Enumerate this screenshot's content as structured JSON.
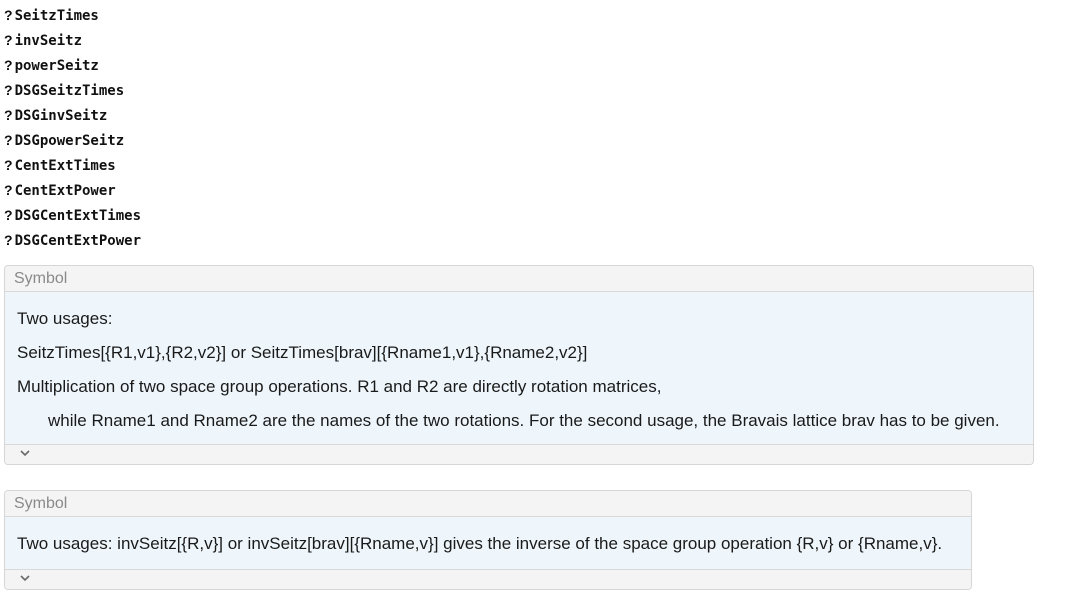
{
  "queries": [
    {
      "mark": "?",
      "name": "SeitzTimes"
    },
    {
      "mark": "?",
      "name": "invSeitz"
    },
    {
      "mark": "?",
      "name": "powerSeitz"
    },
    {
      "mark": "?",
      "name": "DSGSeitzTimes"
    },
    {
      "mark": "?",
      "name": "DSGinvSeitz"
    },
    {
      "mark": "?",
      "name": "DSGpowerSeitz"
    },
    {
      "mark": "?",
      "name": "CentExtTimes"
    },
    {
      "mark": "?",
      "name": "CentExtPower"
    },
    {
      "mark": "?",
      "name": "DSGCentExtTimes"
    },
    {
      "mark": "?",
      "name": "DSGCentExtPower"
    }
  ],
  "panels": [
    {
      "header": "Symbol",
      "lines": [
        "Two usages:",
        "SeitzTimes[{R1,v1},{R2,v2}]  or  SeitzTimes[brav][{Rname1,v1},{Rname2,v2}]",
        "Multiplication of two space group operations. R1 and R2 are directly rotation matrices,",
        "while Rname1 and Rname2 are the names of the two rotations. For the second usage, the Bravais lattice brav has to be given."
      ],
      "footer_icon": "chevron-down-icon"
    },
    {
      "header": "Symbol",
      "lines": [
        "Two usages:  invSeitz[{R,v}]  or  invSeitz[brav][{Rname,v}]  gives the inverse of the space group operation {R,v} or {Rname,v}."
      ],
      "footer_icon": "chevron-down-icon"
    }
  ]
}
